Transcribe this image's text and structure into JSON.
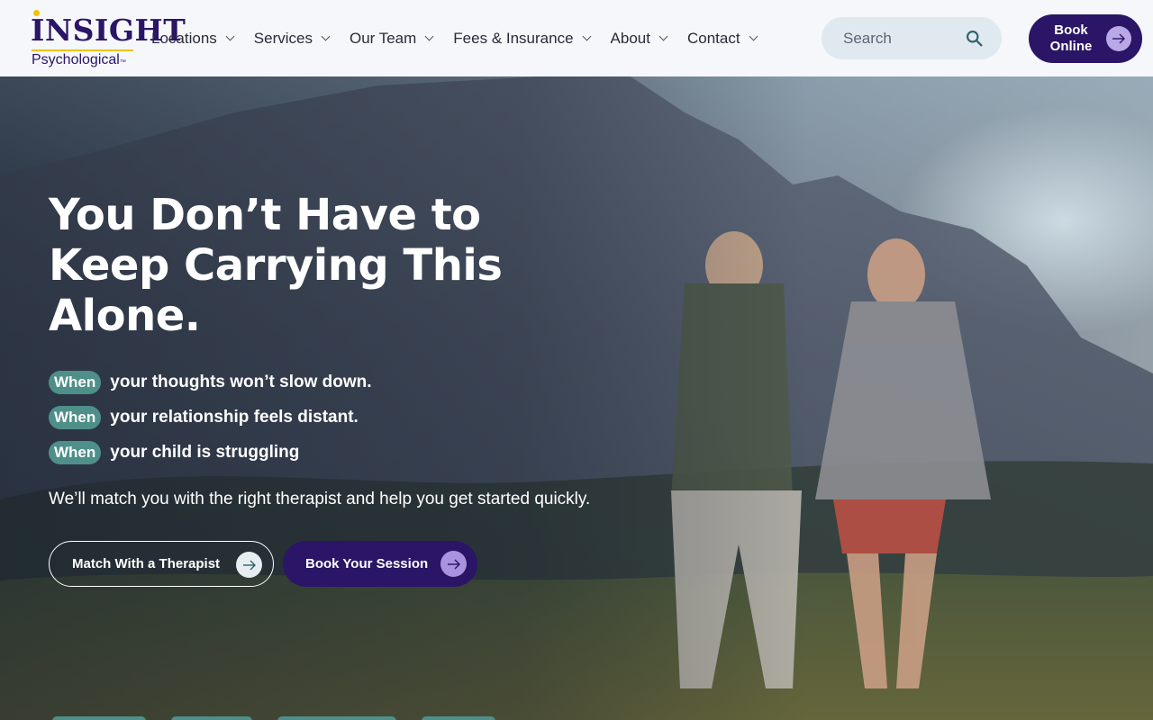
{
  "brand": {
    "name": "INSIGHT",
    "sub": "Psychological",
    "tm": "™"
  },
  "nav": [
    {
      "label": "Locations"
    },
    {
      "label": "Services"
    },
    {
      "label": "Our Team"
    },
    {
      "label": "Fees & Insurance"
    },
    {
      "label": "About"
    },
    {
      "label": "Contact"
    }
  ],
  "search": {
    "placeholder": "Search"
  },
  "book_online": {
    "label": "Book Online"
  },
  "hero": {
    "headline": "You Don’t Have to Keep Carrying This Alone.",
    "when_label": "When",
    "when_items": [
      "your thoughts won’t slow down.",
      "your relationship feels distant.",
      "your child is struggling"
    ],
    "tagline": "We’ll match you with the right therapist and help you get started quickly.",
    "cta_match": "Match With a Therapist",
    "cta_book": "Book Your Session"
  },
  "colors": {
    "brand_purple": "#2a1566",
    "accent_yellow": "#f2c200",
    "teal": "#4f8f8a"
  }
}
